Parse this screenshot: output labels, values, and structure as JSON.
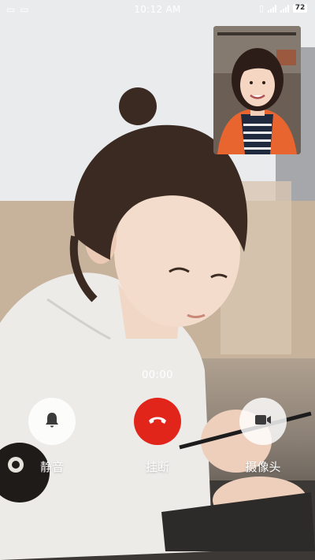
{
  "status_bar": {
    "time": "10:12 AM",
    "battery": "72"
  },
  "call": {
    "timer": "00:00",
    "mute_label": "静音",
    "hangup_label": "挂断",
    "camera_label": "摄像头"
  },
  "colors": {
    "hangup": "#e1251b",
    "control_button_bg": "#ffffff"
  },
  "icons": {
    "mute": "bell-icon",
    "hangup": "phone-hangup-icon",
    "camera": "video-camera-icon"
  }
}
